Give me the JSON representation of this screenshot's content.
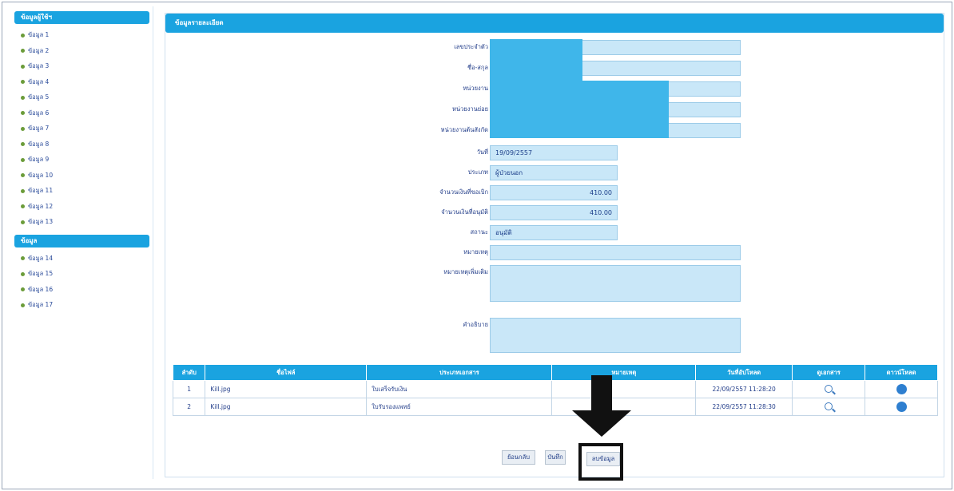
{
  "sidebar": {
    "section1_title": "ข้อมูลผู้ใช้ฯ",
    "items": [
      "ข้อมูล 1",
      "ข้อมูล 2",
      "ข้อมูล 3",
      "ข้อมูล 4",
      "ข้อมูล 5",
      "ข้อมูล 6",
      "ข้อมูล 7",
      "ข้อมูล 8",
      "ข้อมูล 9",
      "ข้อมูล 10",
      "ข้อมูล 11",
      "ข้อมูล 12",
      "ข้อมูล 13"
    ],
    "section2_title": "ข้อมูล",
    "items2": [
      "ข้อมูล 14",
      "ข้อมูล 15",
      "ข้อมูล 16",
      "ข้อมูล 17"
    ]
  },
  "main": {
    "header_title": "ข้อมูลรายละเอียด",
    "fields": {
      "f1_label": "เลขประจำตัว",
      "f1_value": "",
      "f2_label": "ชื่อ-สกุล",
      "f2_value": "",
      "f3_label": "หน่วยงาน",
      "f3_value": "",
      "f4_label": "หน่วยงานย่อย",
      "f4_value": "",
      "f5_label": "หน่วยงานต้นสังกัด",
      "f5_value": "",
      "f6_label": "วันที่",
      "f6_value": "19/09/2557",
      "f7_label": "ประเภท",
      "f7_value": "ผู้ป่วยนอก",
      "f8_label": "จำนวนเงินที่ขอเบิก",
      "f8_value": "410.00",
      "f9_label": "จำนวนเงินที่อนุมัติ",
      "f9_value": "410.00",
      "f10_label": "สถานะ",
      "f10_value": "อนุมัติ",
      "f11_label": "หมายเหตุ",
      "f11_value": "",
      "f12_label": "หมายเหตุเพิ่มเติม",
      "f12_value": "",
      "f13_label": "คำอธิบาย",
      "f13_value": ""
    }
  },
  "table": {
    "headers": [
      "ลำดับ",
      "ชื่อไฟล์",
      "ประเภทเอกสาร",
      "หมายเหตุ",
      "วันที่อัปโหลด",
      "ดูเอกสาร",
      "ดาวน์โหลด"
    ],
    "rows": [
      {
        "no": "1",
        "file": "Kill.jpg",
        "type": "ใบเสร็จรับเงิน",
        "note": "",
        "date": "22/09/2557 11:28:20"
      },
      {
        "no": "2",
        "file": "Kill.jpg",
        "type": "ใบรับรองแพทย์",
        "note": "",
        "date": "22/09/2557 11:28:30"
      }
    ]
  },
  "buttons": {
    "back": "ย้อนกลับ",
    "save": "บันทึก",
    "delete": "ลบข้อมูล"
  }
}
